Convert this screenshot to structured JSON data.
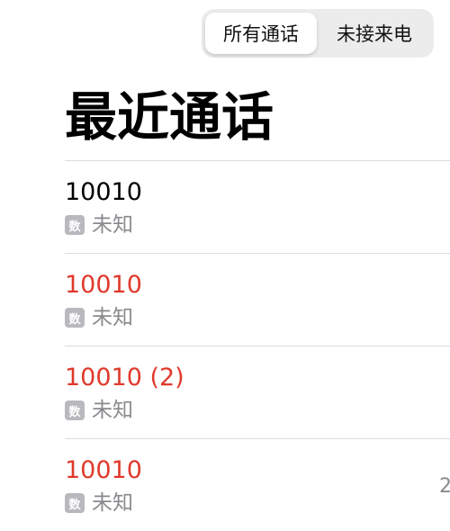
{
  "segmented": {
    "all_calls": "所有通话",
    "missed_calls": "未接来电",
    "selected": "所有通话"
  },
  "page_title": "最近通话",
  "calls": [
    {
      "number": "10010",
      "missed": false,
      "sim": "数",
      "type": "未知",
      "time": ""
    },
    {
      "number": "10010",
      "missed": true,
      "sim": "数",
      "type": "未知",
      "time": ""
    },
    {
      "number": "10010 (2)",
      "missed": true,
      "sim": "数",
      "type": "未知",
      "time": ""
    },
    {
      "number": "10010",
      "missed": true,
      "sim": "数",
      "type": "未知",
      "time": "2"
    }
  ],
  "colors": {
    "missed": "#e0392c",
    "normal": "#000000",
    "secondary": "#8a8a8e"
  }
}
